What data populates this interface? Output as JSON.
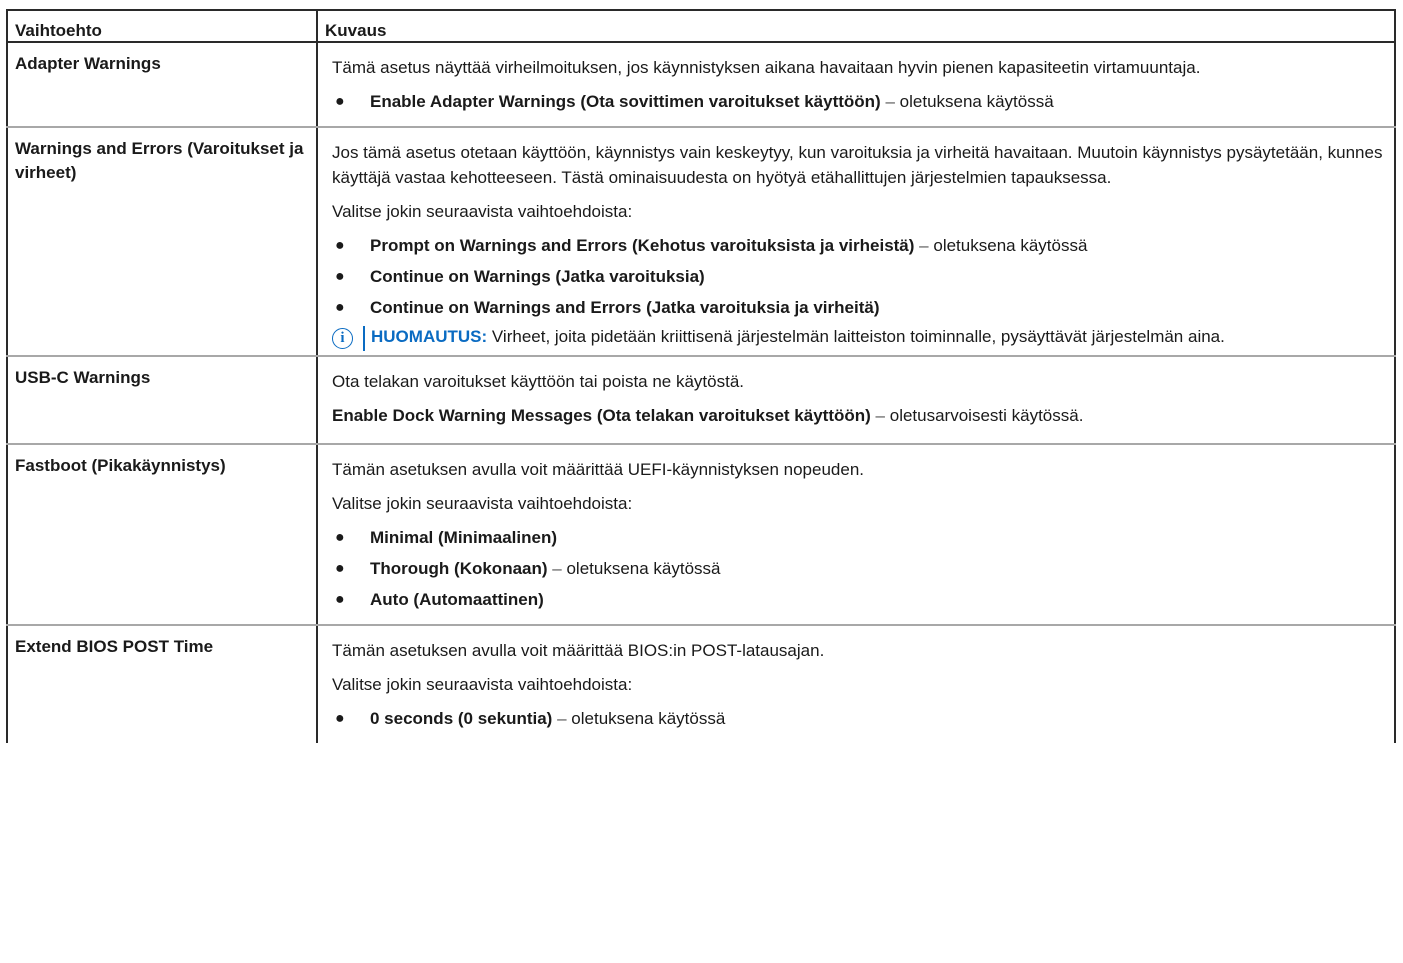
{
  "header": {
    "col1": "Vaihtoehto",
    "col2": "Kuvaus"
  },
  "rows": [
    {
      "option": "Adapter Warnings",
      "desc": "Tämä asetus näyttää virheilmoituksen, jos käynnistyksen aikana havaitaan hyvin pienen kapasiteetin virtamuuntaja.",
      "bullets": [
        {
          "bold": "Enable Adapter Warnings (Ota sovittimen varoitukset käyttöön)",
          "sep": "–",
          "rest": "oletuksena käytössä"
        }
      ]
    },
    {
      "option": "Warnings and Errors (Varoitukset ja virheet)",
      "desc": "Jos tämä asetus otetaan käyttöön, käynnistys vain keskeytyy, kun varoituksia ja virheitä havaitaan. Muutoin käynnistys pysäytetään, kunnes käyttäjä vastaa kehotteeseen. Tästä ominaisuudesta on hyötyä etähallittujen järjestelmien tapauksessa.",
      "choose": "Valitse jokin seuraavista vaihtoehdoista:",
      "bullets": [
        {
          "bold": "Prompt on Warnings and Errors (Kehotus varoituksista ja virheistä)",
          "sep": "–",
          "rest": "oletuksena käytössä"
        },
        {
          "bold": "Continue on Warnings (Jatka varoituksia)",
          "sep": "",
          "rest": ""
        },
        {
          "bold": "Continue on Warnings and Errors (Jatka varoituksia ja virheitä)",
          "sep": "",
          "rest": ""
        }
      ],
      "note": {
        "label": "HUOMAUTUS:",
        "text": "Virheet, joita pidetään kriittisenä järjestelmän laitteiston toiminnalle, pysäyttävät järjestelmän aina."
      }
    },
    {
      "option": "USB-C Warnings",
      "desc": "Ota telakan varoitukset käyttöön tai poista ne käytöstä.",
      "line": {
        "bold": "Enable Dock Warning Messages (Ota telakan varoitukset käyttöön)",
        "sep": "–",
        "rest": "oletusarvoisesti käytössä."
      }
    },
    {
      "option": "Fastboot (Pikakäynnistys)",
      "desc": "Tämän asetuksen avulla voit määrittää UEFI-käynnistyksen nopeuden.",
      "choose": "Valitse jokin seuraavista vaihtoehdoista:",
      "bullets": [
        {
          "bold": "Minimal (Minimaalinen)",
          "sep": "",
          "rest": ""
        },
        {
          "bold": "Thorough (Kokonaan)",
          "sep": "–",
          "rest": "oletuksena käytössä"
        },
        {
          "bold": "Auto (Automaattinen)",
          "sep": "",
          "rest": ""
        }
      ]
    },
    {
      "option": "Extend BIOS POST Time",
      "desc": "Tämän asetuksen avulla voit määrittää BIOS:in POST-latausajan.",
      "choose": "Valitse jokin seuraavista vaihtoehdoista:",
      "bullets": [
        {
          "bold": "0 seconds (0 sekuntia)",
          "sep": "–",
          "rest": "oletuksena käytössä"
        }
      ]
    }
  ],
  "icons": {
    "note": "info-icon",
    "bullet": "●"
  },
  "colors": {
    "note_accent": "#0a6bc2",
    "header_border": "#2a2a2a",
    "row_border": "#a8a8a8"
  }
}
